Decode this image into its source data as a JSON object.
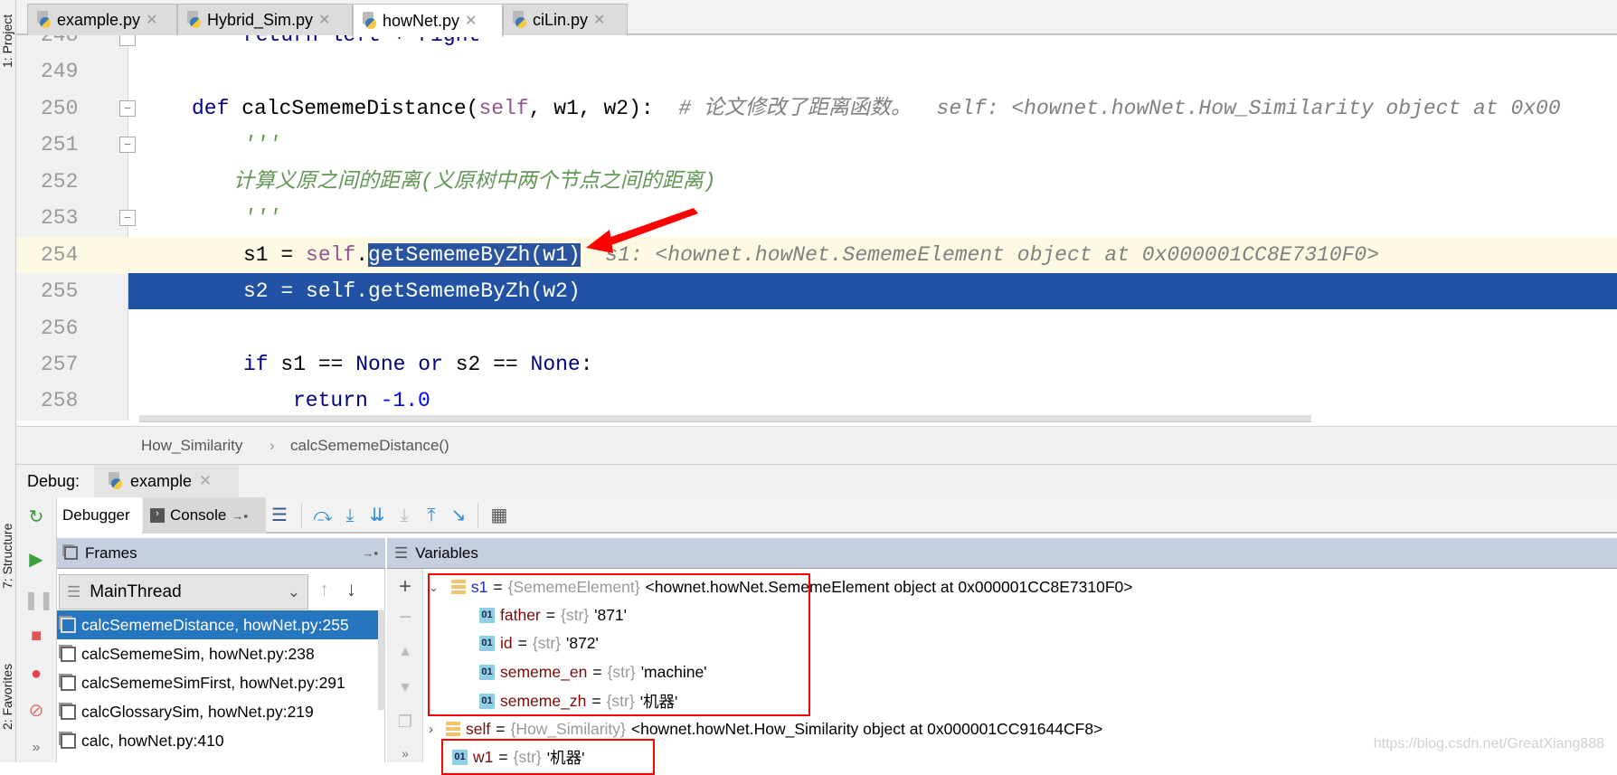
{
  "side_tools": {
    "project": "1: Project",
    "structure": "7: Structure",
    "favorites": "2: Favorites"
  },
  "tabs": [
    {
      "label": "example.py",
      "active": false
    },
    {
      "label": "Hybrid_Sim.py",
      "active": false
    },
    {
      "label": "howNet.py",
      "active": true
    },
    {
      "label": "ciLin.py",
      "active": false
    }
  ],
  "editor": {
    "lines": [
      {
        "n": "248",
        "code": "return left + right"
      },
      {
        "n": "249",
        "code": ""
      },
      {
        "n": "250",
        "kw": "def ",
        "fn": "calcSememeDistance(",
        "self": "self",
        ",rest": "",
        "args": ", w1, w2):",
        "comment": "# 论文修改了距离函数。",
        "hint": "self: <hownet.howNet.How_Similarity object at 0x00"
      },
      {
        "n": "251",
        "code": "'''"
      },
      {
        "n": "252",
        "code": "计算义原之间的距离(义原树中两个节点之间的距离)"
      },
      {
        "n": "253",
        "code": "'''"
      },
      {
        "n": "254",
        "pre": "s1 = ",
        "self": "self",
        "dot": ".",
        "selected": "getSememeByZh(w1)",
        "hint": "s1: <hownet.howNet.SememeElement object at 0x000001CC8E7310F0>"
      },
      {
        "n": "255",
        "code": "s2 = self.getSememeByZh(w2)"
      },
      {
        "n": "256",
        "code": ""
      },
      {
        "n": "257",
        "kw1": "if ",
        "a": "s1 == ",
        "none1": "None",
        "or": " or ",
        "b": "s2 == ",
        "none2": "None",
        ":": ":"
      },
      {
        "n": "258",
        "kw": "return ",
        "num": "-1.0"
      }
    ]
  },
  "breadcrumb": {
    "class": "How_Similarity",
    "sep": "›",
    "method": "calcSememeDistance()"
  },
  "debug": {
    "label": "Debug:",
    "session": "example"
  },
  "toolbar": {
    "debugger": "Debugger",
    "console": "Console"
  },
  "frames": {
    "title": "Frames",
    "thread": "MainThread",
    "items": [
      "calcSememeDistance, howNet.py:255",
      "calcSememeSim, howNet.py:238",
      "calcSememeSimFirst, howNet.py:291",
      "calcGlossarySim, howNet.py:219",
      "calc, howNet.py:410"
    ]
  },
  "variables": {
    "title": "Variables",
    "items": [
      {
        "name": "s1",
        "type": "{SememeElement}",
        "value": "<hownet.howNet.SememeElement object at 0x000001CC8E7310F0>",
        "expanded": true
      },
      {
        "name": "father",
        "type": "{str}",
        "value": "'871'"
      },
      {
        "name": "id",
        "type": "{str}",
        "value": "'872'"
      },
      {
        "name": "sememe_en",
        "type": "{str}",
        "value": "'machine'"
      },
      {
        "name": "sememe_zh",
        "type": "{str}",
        "value": "'机器'"
      },
      {
        "name": "self",
        "type": "{How_Similarity}",
        "value": "<hownet.howNet.How_Similarity object at 0x000001CC91644CF8>",
        "expanded": false
      },
      {
        "name": "w1",
        "type": "{str}",
        "value": "'机器'"
      }
    ]
  },
  "watermark": "https://blog.csdn.net/GreatXiang888",
  "colors": {
    "selection": "#2152a3",
    "current_line": "#fdf9e3",
    "frame_selected": "#2675bf",
    "annotation": "#ff0000"
  }
}
